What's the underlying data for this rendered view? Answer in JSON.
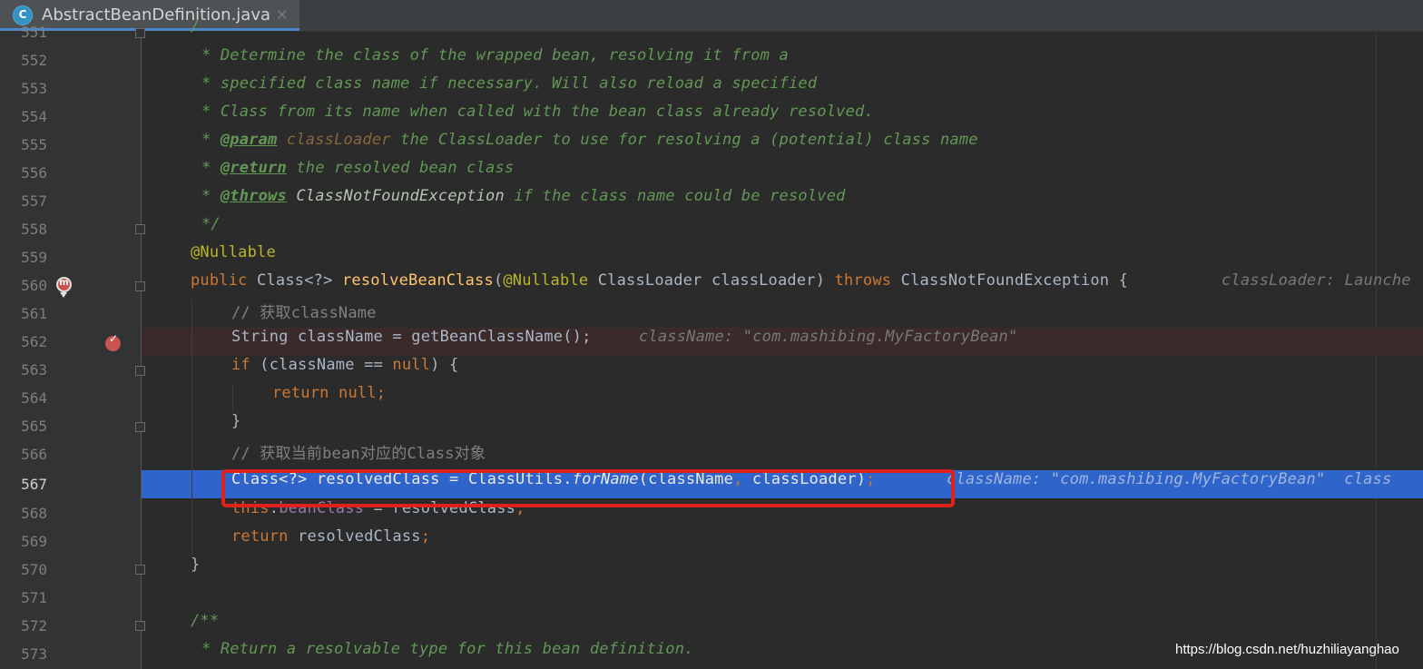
{
  "tab": {
    "icon_letter": "C",
    "title": "AbstractBeanDefinition.java",
    "close": "×"
  },
  "line_numbers": [
    "551",
    "552",
    "553",
    "554",
    "555",
    "556",
    "557",
    "558",
    "559",
    "560",
    "561",
    "562",
    "563",
    "564",
    "565",
    "566",
    "567",
    "568",
    "569",
    "570",
    "571",
    "572",
    "573"
  ],
  "lines": {
    "l551": "/",
    "l552": "* Determine the class of the wrapped bean, resolving it from a",
    "l553": "* specified class name if necessary. Will also reload a specified",
    "l554": "* Class from its name when called with the bean class already resolved.",
    "l555": {
      "star": "* ",
      "tag": "@param",
      "param": "classLoader",
      "text": " the ClassLoader to use for resolving a (potential) class name"
    },
    "l556": {
      "star": "* ",
      "tag": "@return",
      "text": " the resolved bean class"
    },
    "l557": {
      "star": "* ",
      "tag": "@throws",
      "ref": "ClassNotFoundException",
      "text": " if the class name could be resolved"
    },
    "l558": "*/",
    "l559": "@Nullable",
    "l560": {
      "kw_public": "public",
      "type": " Class<?> ",
      "method": "resolveBeanClass",
      "paren": "(",
      "ann": "@Nullable",
      "params": " ClassLoader classLoader) ",
      "kw_throws": "throws",
      "exc": " ClassNotFoundException {",
      "hint": "classLoader: Launche"
    },
    "l561": "// 获取className",
    "l562": {
      "code": "String className = getBeanClassName();",
      "hint": "className: \"com.mashibing.MyFactoryBean\""
    },
    "l563": {
      "kw_if": "if",
      "cond": " (className == ",
      "kw_null": "null",
      "brace": ") {"
    },
    "l564": {
      "kw_return": "return",
      "kw_null": " null",
      "semi": ";"
    },
    "l565": "}",
    "l566": "// 获取当前bean对应的Class对象",
    "l567": {
      "lhs": "Class<?> resolvedClass = ClassUtils.",
      "method": "forName",
      "args1": "(className",
      "comma": ",",
      "args2": " classLoader)",
      "semi": ";",
      "hint": "className: \"com.mashibing.MyFactoryBean\"  class"
    },
    "l568": {
      "kw_this": "this",
      "dot": ".",
      "field": "beanClass",
      "rest": " = resolvedClass",
      "semi": ";"
    },
    "l569": {
      "kw_return": "return",
      "rest": " resolvedClass",
      "semi": ";"
    },
    "l570": "}",
    "l571": "",
    "l572": "/**",
    "l573": "* Return a resolvable type for this bean definition."
  },
  "watermark": "https://blog.csdn.net/huzhiliayanghao"
}
